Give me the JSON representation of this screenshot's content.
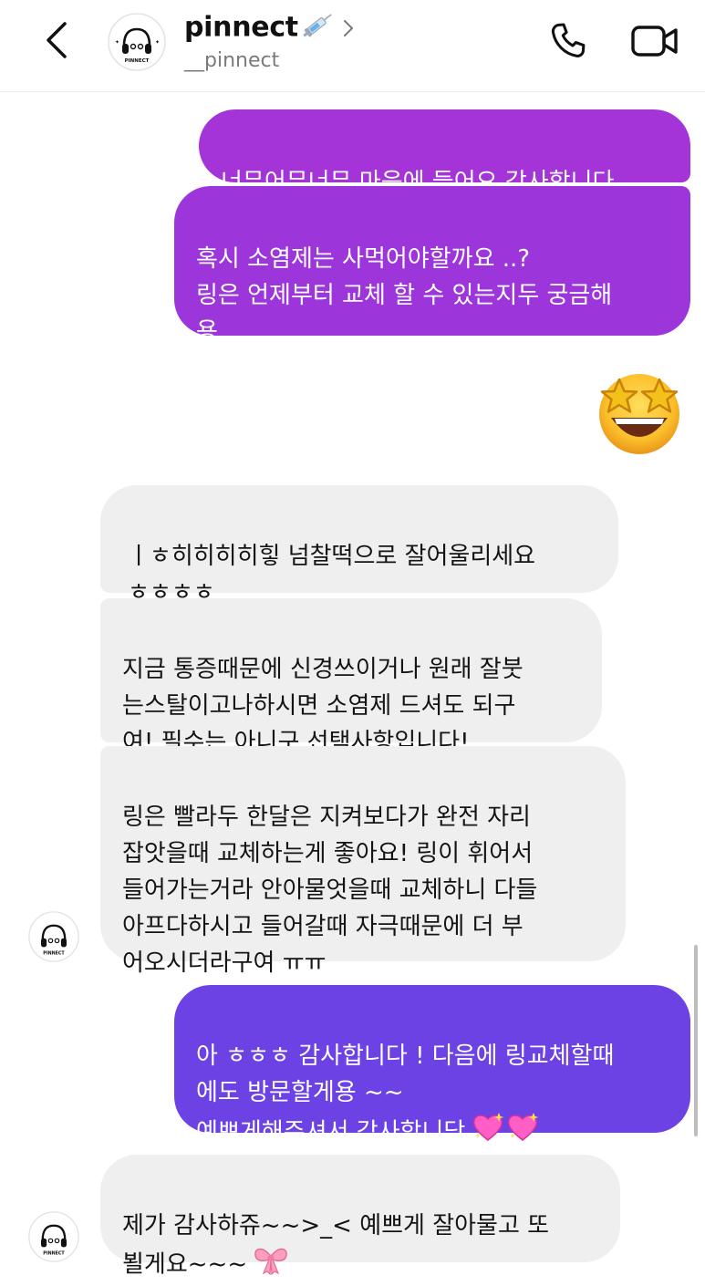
{
  "header": {
    "name": "pinnect",
    "name_emoji": "syringe-icon",
    "handle": "__pinnect",
    "avatar_text": "PINNECT"
  },
  "messages": [
    {
      "direction": "outgoing",
      "text": "너무어무너무 마음에 들어요 감사합니다"
    },
    {
      "direction": "outgoing",
      "text": "혹시 소염제는 사먹어야할까요 ..?\n링은 언제부터 교체 할 수 있는지두 궁금해\n용..."
    },
    {
      "direction": "incoming",
      "text": "ㅣㅎ히히히히힣 넘찰떡으로 잘어울리세요\nㅎㅎㅎㅎ"
    },
    {
      "direction": "incoming",
      "text": "지금 통증때문에 신경쓰이거나 원래 잘붓\n는스탈이고나하시면 소염제 드셔도 되구\n여! 필수는 아니구 선택사항입니다!"
    },
    {
      "direction": "incoming",
      "text": "링은 빨라두 한달은 지켜보다가 완전 자리\n잡앗을때 교체하는게 좋아요! 링이 휘어서\n들어가는거라 안아물엇을때 교체하니 다들\n아프다하시고 들어갈때 자극때문에 더 부\n어오시더라구여 ㅠㅠ"
    },
    {
      "direction": "outgoing",
      "text": "아 ㅎㅎㅎ 감사합니다 ! 다음에 링교체할때\n에도 방문할게용 ~~\n예쁘게해주셔서 감사합니당",
      "trailing_emoji": "sparkling-heart-icon x2"
    },
    {
      "direction": "incoming",
      "text": "제가 감사하쥬~~>_< 예쁘게 잘아물고 또\n뵐게요~~~",
      "trailing_emoji": "ribbon-icon"
    }
  ],
  "reaction_emoji": "star-struck-emoji",
  "colors": {
    "outgoing_purple": "#a434d8",
    "outgoing_violet": "#6c42e4",
    "incoming_gray": "#efefef"
  }
}
